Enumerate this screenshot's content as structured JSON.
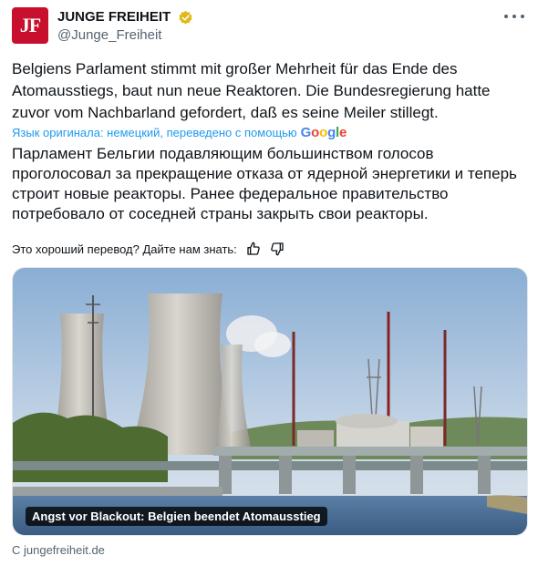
{
  "author": {
    "avatar_text": "JF",
    "display_name": "JUNGE FREIHEIT",
    "handle": "@Junge_Freiheit"
  },
  "tweet": {
    "text": "Belgiens Parlament stimmt mit großer Mehrheit für das Ende des Atomausstiegs, baut nun neue Reaktoren. Die Bundesregierung hatte zuvor vom Nachbarland gefordert, daß es seine Meiler stillegt.",
    "translation_note": "Язык оригинала: немецкий, переведено с помощью",
    "translation_provider": "Google",
    "translated_text": "Парламент Бельгии подавляющим большинством голосов проголосовал за прекращение отказа от ядерной энергетики и теперь строит новые реакторы. Ранее федеральное правительство потребовало от соседней страны закрыть свои реакторы.",
    "feedback_prompt": "Это хороший перевод? Дайте нам знать:"
  },
  "card": {
    "caption": "Angst vor Blackout: Belgien beendet Atomausstieg",
    "source": "С jungefreiheit.de"
  },
  "colors": {
    "accent": "#1d9bf0",
    "brand_red": "#c8102e",
    "verified_gold": "#e2b719"
  },
  "icons": [
    "verified-badge-icon",
    "more-icon",
    "thumbs-up-icon",
    "thumbs-down-icon"
  ]
}
